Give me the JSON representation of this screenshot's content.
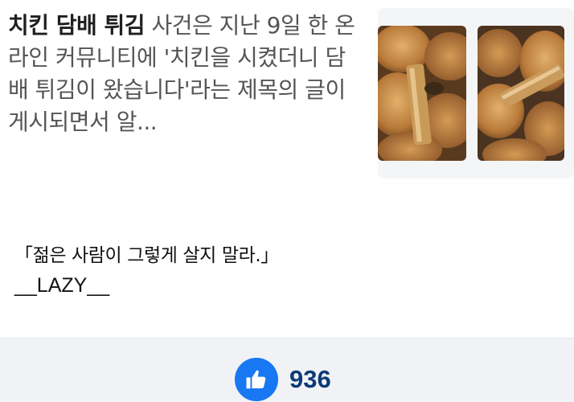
{
  "news": {
    "headline_bold": "치킨 담배 튀김",
    "snippet_rest": " 사건은 지난 9일 한 온라인 커뮤니티에 '치킨을 시켰더니 담배 튀김이 왔습니다'라는 제목의 글이 게시되면서 알...",
    "thumbnail_icon": "fried-chicken-photo"
  },
  "comment": {
    "quote": "「젊은 사람이 그렇게 살지 말라.」",
    "author": "__LAZY__"
  },
  "reaction": {
    "like_icon": "thumbs-up-icon",
    "like_color": "#1877f2",
    "like_count": "936"
  }
}
